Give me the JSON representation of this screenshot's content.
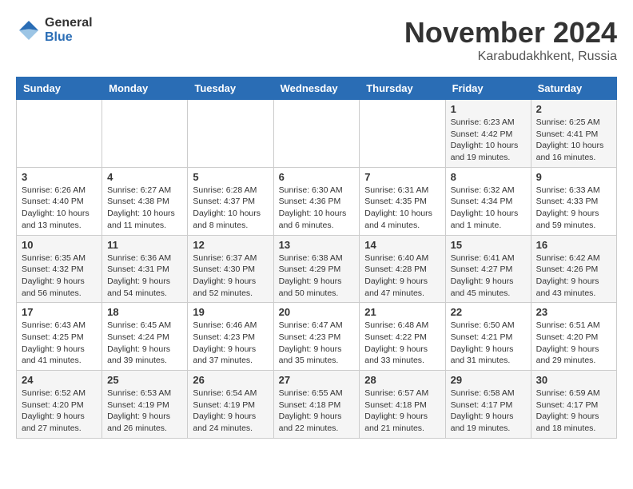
{
  "logo": {
    "general": "General",
    "blue": "Blue"
  },
  "title": "November 2024",
  "location": "Karabudakhkent, Russia",
  "days_of_week": [
    "Sunday",
    "Monday",
    "Tuesday",
    "Wednesday",
    "Thursday",
    "Friday",
    "Saturday"
  ],
  "weeks": [
    {
      "days": [
        {
          "number": "",
          "detail": ""
        },
        {
          "number": "",
          "detail": ""
        },
        {
          "number": "",
          "detail": ""
        },
        {
          "number": "",
          "detail": ""
        },
        {
          "number": "",
          "detail": ""
        },
        {
          "number": "1",
          "detail": "Sunrise: 6:23 AM\nSunset: 4:42 PM\nDaylight: 10 hours and 19 minutes."
        },
        {
          "number": "2",
          "detail": "Sunrise: 6:25 AM\nSunset: 4:41 PM\nDaylight: 10 hours and 16 minutes."
        }
      ]
    },
    {
      "days": [
        {
          "number": "3",
          "detail": "Sunrise: 6:26 AM\nSunset: 4:40 PM\nDaylight: 10 hours and 13 minutes."
        },
        {
          "number": "4",
          "detail": "Sunrise: 6:27 AM\nSunset: 4:38 PM\nDaylight: 10 hours and 11 minutes."
        },
        {
          "number": "5",
          "detail": "Sunrise: 6:28 AM\nSunset: 4:37 PM\nDaylight: 10 hours and 8 minutes."
        },
        {
          "number": "6",
          "detail": "Sunrise: 6:30 AM\nSunset: 4:36 PM\nDaylight: 10 hours and 6 minutes."
        },
        {
          "number": "7",
          "detail": "Sunrise: 6:31 AM\nSunset: 4:35 PM\nDaylight: 10 hours and 4 minutes."
        },
        {
          "number": "8",
          "detail": "Sunrise: 6:32 AM\nSunset: 4:34 PM\nDaylight: 10 hours and 1 minute."
        },
        {
          "number": "9",
          "detail": "Sunrise: 6:33 AM\nSunset: 4:33 PM\nDaylight: 9 hours and 59 minutes."
        }
      ]
    },
    {
      "days": [
        {
          "number": "10",
          "detail": "Sunrise: 6:35 AM\nSunset: 4:32 PM\nDaylight: 9 hours and 56 minutes."
        },
        {
          "number": "11",
          "detail": "Sunrise: 6:36 AM\nSunset: 4:31 PM\nDaylight: 9 hours and 54 minutes."
        },
        {
          "number": "12",
          "detail": "Sunrise: 6:37 AM\nSunset: 4:30 PM\nDaylight: 9 hours and 52 minutes."
        },
        {
          "number": "13",
          "detail": "Sunrise: 6:38 AM\nSunset: 4:29 PM\nDaylight: 9 hours and 50 minutes."
        },
        {
          "number": "14",
          "detail": "Sunrise: 6:40 AM\nSunset: 4:28 PM\nDaylight: 9 hours and 47 minutes."
        },
        {
          "number": "15",
          "detail": "Sunrise: 6:41 AM\nSunset: 4:27 PM\nDaylight: 9 hours and 45 minutes."
        },
        {
          "number": "16",
          "detail": "Sunrise: 6:42 AM\nSunset: 4:26 PM\nDaylight: 9 hours and 43 minutes."
        }
      ]
    },
    {
      "days": [
        {
          "number": "17",
          "detail": "Sunrise: 6:43 AM\nSunset: 4:25 PM\nDaylight: 9 hours and 41 minutes."
        },
        {
          "number": "18",
          "detail": "Sunrise: 6:45 AM\nSunset: 4:24 PM\nDaylight: 9 hours and 39 minutes."
        },
        {
          "number": "19",
          "detail": "Sunrise: 6:46 AM\nSunset: 4:23 PM\nDaylight: 9 hours and 37 minutes."
        },
        {
          "number": "20",
          "detail": "Sunrise: 6:47 AM\nSunset: 4:23 PM\nDaylight: 9 hours and 35 minutes."
        },
        {
          "number": "21",
          "detail": "Sunrise: 6:48 AM\nSunset: 4:22 PM\nDaylight: 9 hours and 33 minutes."
        },
        {
          "number": "22",
          "detail": "Sunrise: 6:50 AM\nSunset: 4:21 PM\nDaylight: 9 hours and 31 minutes."
        },
        {
          "number": "23",
          "detail": "Sunrise: 6:51 AM\nSunset: 4:20 PM\nDaylight: 9 hours and 29 minutes."
        }
      ]
    },
    {
      "days": [
        {
          "number": "24",
          "detail": "Sunrise: 6:52 AM\nSunset: 4:20 PM\nDaylight: 9 hours and 27 minutes."
        },
        {
          "number": "25",
          "detail": "Sunrise: 6:53 AM\nSunset: 4:19 PM\nDaylight: 9 hours and 26 minutes."
        },
        {
          "number": "26",
          "detail": "Sunrise: 6:54 AM\nSunset: 4:19 PM\nDaylight: 9 hours and 24 minutes."
        },
        {
          "number": "27",
          "detail": "Sunrise: 6:55 AM\nSunset: 4:18 PM\nDaylight: 9 hours and 22 minutes."
        },
        {
          "number": "28",
          "detail": "Sunrise: 6:57 AM\nSunset: 4:18 PM\nDaylight: 9 hours and 21 minutes."
        },
        {
          "number": "29",
          "detail": "Sunrise: 6:58 AM\nSunset: 4:17 PM\nDaylight: 9 hours and 19 minutes."
        },
        {
          "number": "30",
          "detail": "Sunrise: 6:59 AM\nSunset: 4:17 PM\nDaylight: 9 hours and 18 minutes."
        }
      ]
    }
  ]
}
